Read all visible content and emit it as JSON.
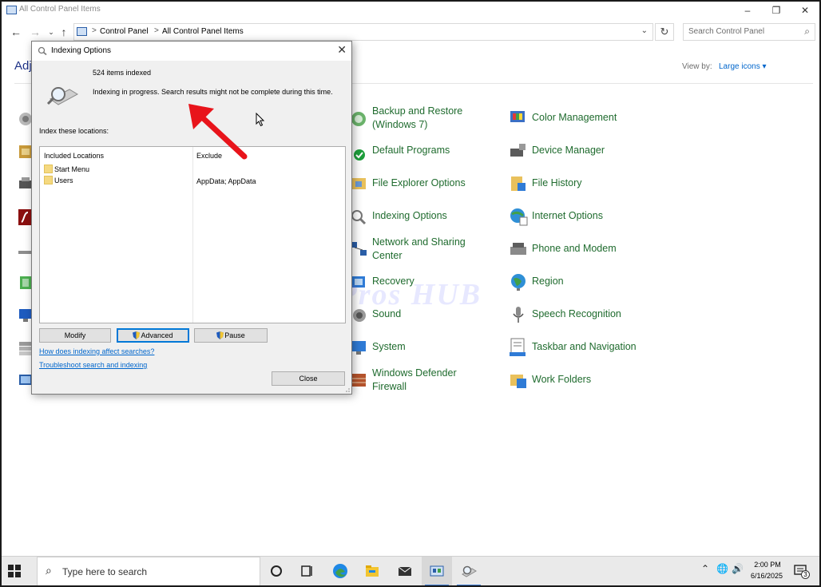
{
  "window": {
    "title": "All Control Panel Items",
    "min_glyph": "–",
    "max_glyph": "❐",
    "close_glyph": "✕"
  },
  "address": {
    "sep": ">",
    "crumbs": [
      "Control Panel",
      "All Control Panel Items"
    ],
    "search_placeholder": "Search Control Panel"
  },
  "header": {
    "adjust_text": "Adj",
    "view_by_label": "View by:",
    "view_by_value": "Large icons ▾"
  },
  "items": {
    "col1": [
      {
        "label": "Backup and Restore (Windows 7)",
        "icon": "backup-icon"
      },
      {
        "label": "Default Programs",
        "icon": "default-programs-icon"
      },
      {
        "label": "File Explorer Options",
        "icon": "folder-options-icon"
      },
      {
        "label": "Indexing Options",
        "icon": "indexing-icon"
      },
      {
        "label": "Network and Sharing Center",
        "icon": "network-icon"
      },
      {
        "label": "Recovery",
        "icon": "recovery-icon"
      },
      {
        "label": "Sound",
        "icon": "speaker-icon"
      },
      {
        "label": "System",
        "icon": "system-icon"
      },
      {
        "label": "Windows Defender Firewall",
        "icon": "firewall-icon"
      }
    ],
    "col2": [
      {
        "label": "Color Management",
        "icon": "color-management-icon"
      },
      {
        "label": "Device Manager",
        "icon": "device-manager-icon"
      },
      {
        "label": "File History",
        "icon": "file-history-icon"
      },
      {
        "label": "Internet Options",
        "icon": "internet-options-icon"
      },
      {
        "label": "Phone and Modem",
        "icon": "phone-icon"
      },
      {
        "label": "Region",
        "icon": "globe-icon"
      },
      {
        "label": "Speech Recognition",
        "icon": "microphone-icon"
      },
      {
        "label": "Taskbar and Navigation",
        "icon": "taskbar-icon"
      },
      {
        "label": "Work Folders",
        "icon": "work-folders-icon"
      }
    ]
  },
  "dialog": {
    "title": "Indexing Options",
    "close_glyph": "✕",
    "items_indexed": "524 items indexed",
    "status": "Indexing in progress. Search results might not be complete during this time.",
    "index_label": "Index these locations:",
    "columns": [
      "Included Locations",
      "Exclude"
    ],
    "rows": [
      {
        "location": "Start Menu",
        "exclude": ""
      },
      {
        "location": "Users",
        "exclude": "AppData; AppData"
      }
    ],
    "buttons": {
      "modify": "Modify",
      "advanced": "Advanced",
      "pause": "Pause",
      "close": "Close"
    },
    "links": [
      "How does indexing affect searches?",
      "Troubleshoot search and indexing"
    ]
  },
  "watermark": "IT Pros HUB",
  "taskbar": {
    "search_placeholder": "Type here to search",
    "time": "2:00 PM",
    "date": "6/16/2025",
    "notification_count": "3",
    "tray_up_glyph": "⌃",
    "tray_network_glyph": "🌐",
    "tray_volume_glyph": "🔊"
  },
  "colors": {
    "link_green": "#1f6b2e",
    "accent_blue": "#0078d7",
    "arrow_red": "#e8141b"
  }
}
